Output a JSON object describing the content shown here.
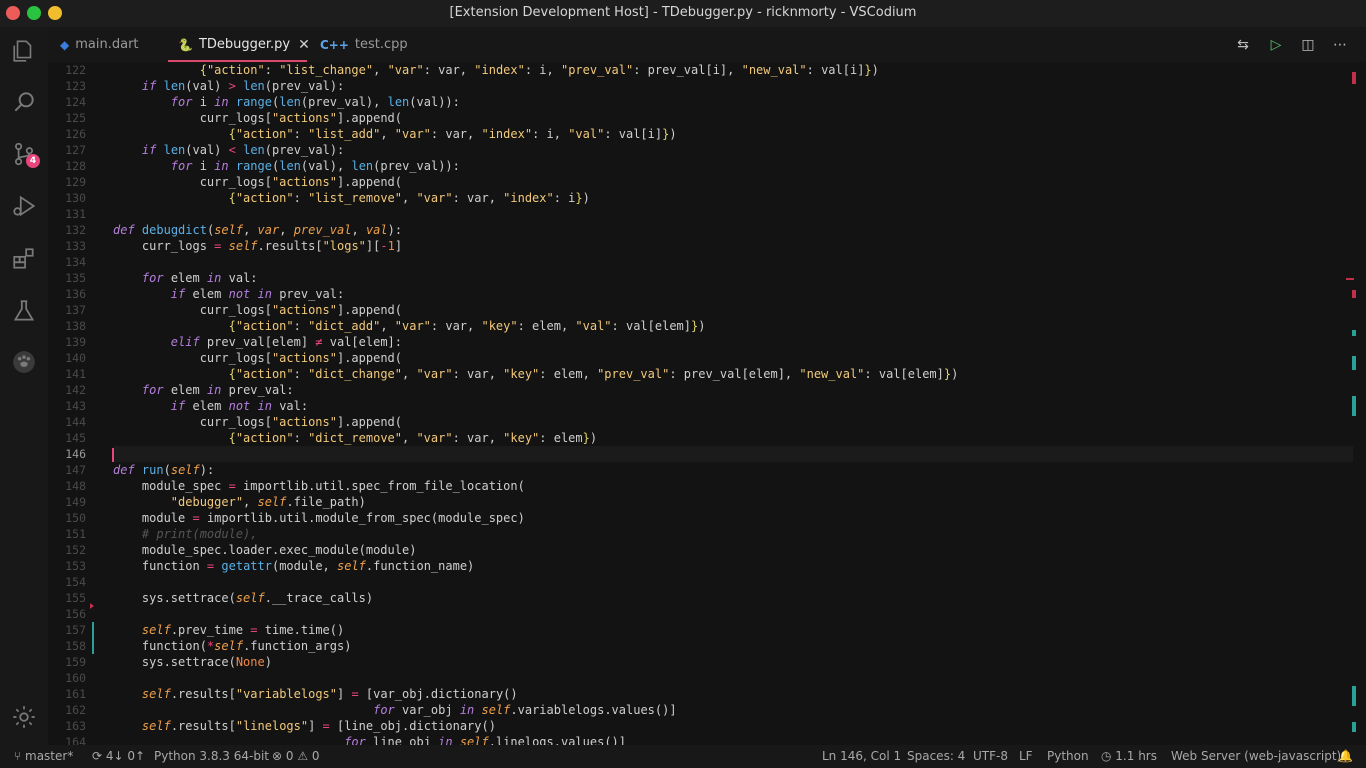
{
  "window": {
    "title": "[Extension Development Host] - TDebugger.py - ricknmorty - VSCodium"
  },
  "activity": {
    "items": [
      "explorer-icon",
      "search-icon",
      "source-control-icon",
      "run-debug-icon",
      "extensions-icon",
      "testing-icon",
      "paw-icon",
      "settings-gear-icon"
    ],
    "scm_badge": "4"
  },
  "tabs": [
    {
      "label": "main.dart",
      "icon": "dart-icon",
      "active": false
    },
    {
      "label": "TDebugger.py",
      "icon": "python-icon",
      "active": true
    },
    {
      "label": "test.cpp",
      "icon": "cpp-icon",
      "active": false
    }
  ],
  "editor": {
    "line_numbers": [
      "122",
      "123",
      "124",
      "125",
      "126",
      "127",
      "128",
      "129",
      "130",
      "131",
      "132",
      "133",
      "134",
      "135",
      "136",
      "137",
      "138",
      "139",
      "140",
      "141",
      "142",
      "143",
      "144",
      "145",
      "146",
      "147",
      "148",
      "149",
      "150",
      "151",
      "152",
      "153",
      "154",
      "155",
      "156",
      "157",
      "158",
      "159",
      "160",
      "161",
      "162",
      "163",
      "164"
    ],
    "current_line": "146"
  },
  "status": {
    "branch": "master*",
    "sync": "4↓ 0↑",
    "python": "Python 3.8.3 64-bit",
    "problems": "0 ⚠ 0",
    "errors_count": "0",
    "warnings_count": "0",
    "position": "Ln 146, Col 1",
    "spaces": "Spaces: 4",
    "encoding": "UTF-8",
    "eol": "LF",
    "language": "Python",
    "time": "1.1 hrs",
    "server": "Web Server (web-javascript)"
  },
  "colors": {
    "accent": "#e8467a",
    "bg": "#131313",
    "keyword": "#b57edc",
    "string": "#f2c97a",
    "function": "#5ab0e6"
  }
}
